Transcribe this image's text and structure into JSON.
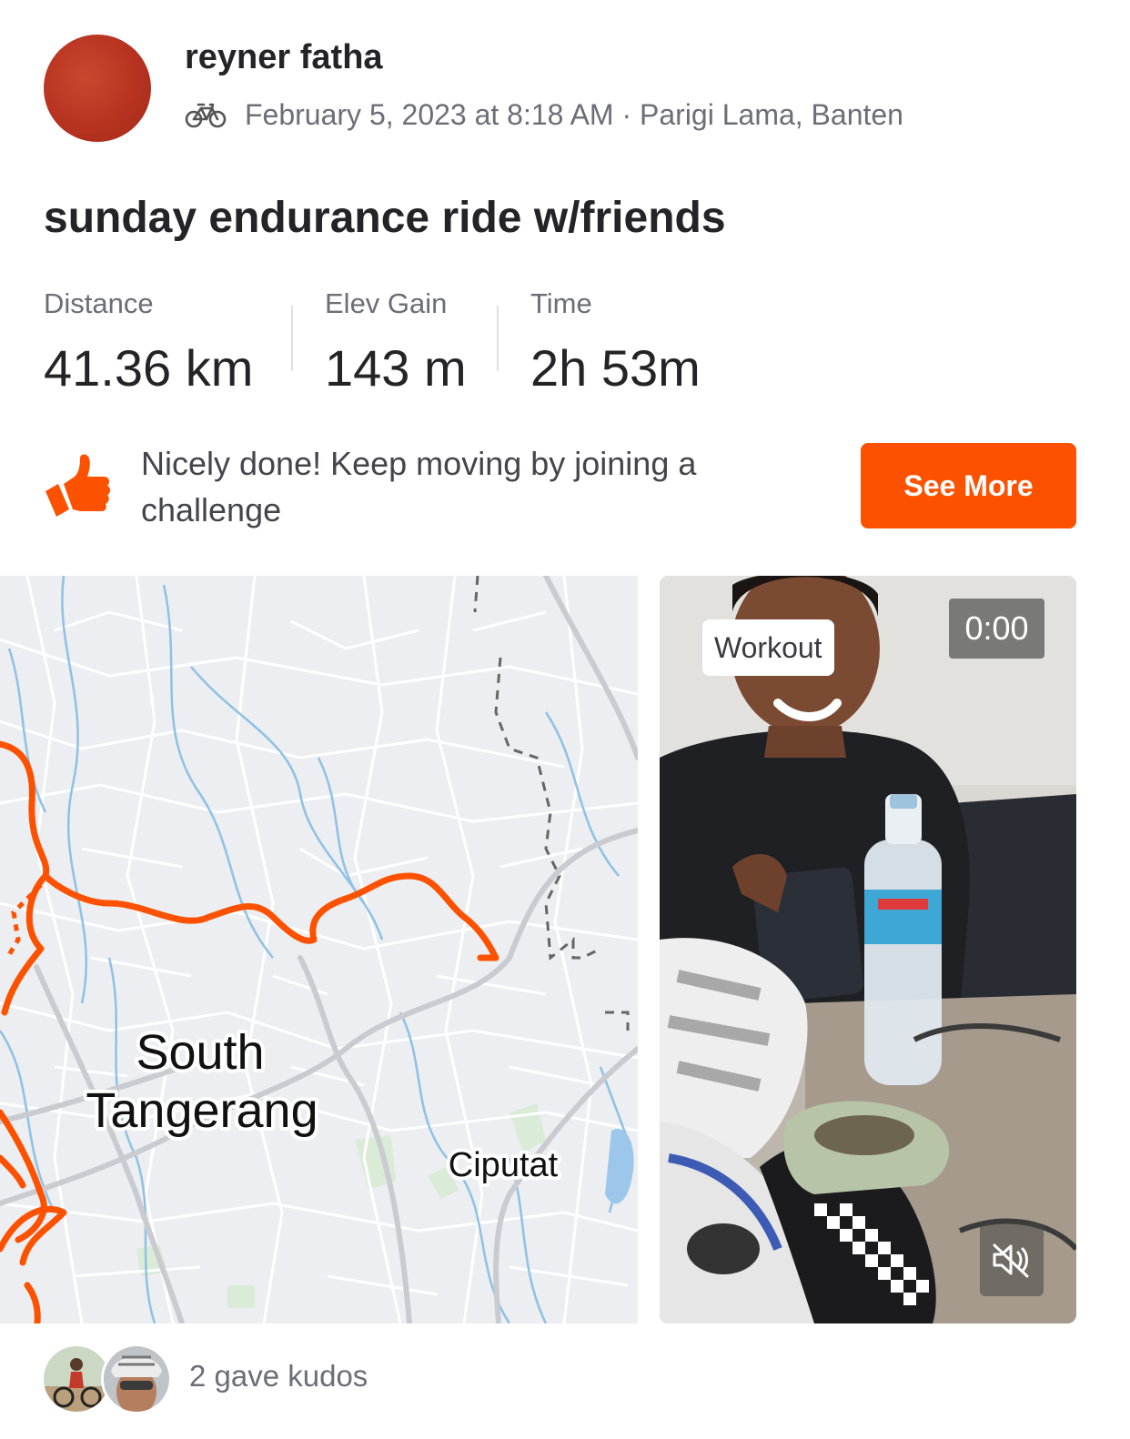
{
  "header": {
    "user_name": "reyner fatha",
    "activity_type_icon": "bicycle-icon",
    "meta": "February 5, 2023 at 8:18 AM · Parigi Lama, Banten"
  },
  "activity": {
    "title": "sunday endurance ride w/friends",
    "stats": [
      {
        "label": "Distance",
        "value": "41.36 km"
      },
      {
        "label": "Elev Gain",
        "value": "143 m"
      },
      {
        "label": "Time",
        "value": "2h 53m"
      }
    ]
  },
  "promo": {
    "icon": "thumbs-up-icon",
    "text": "Nicely done! Keep moving by joining a challenge",
    "button_label": "See More"
  },
  "map": {
    "labels": [
      "South",
      "Tangerang",
      "Ciputat"
    ],
    "route_color": "#fc5200"
  },
  "media": {
    "badge": "Workout",
    "timer": "0:00",
    "mute_icon": "muted-speaker-icon"
  },
  "kudos": {
    "text": "2 gave kudos"
  },
  "colors": {
    "accent": "#fc5200",
    "text_primary": "#242428",
    "text_secondary": "#6d6d78"
  }
}
